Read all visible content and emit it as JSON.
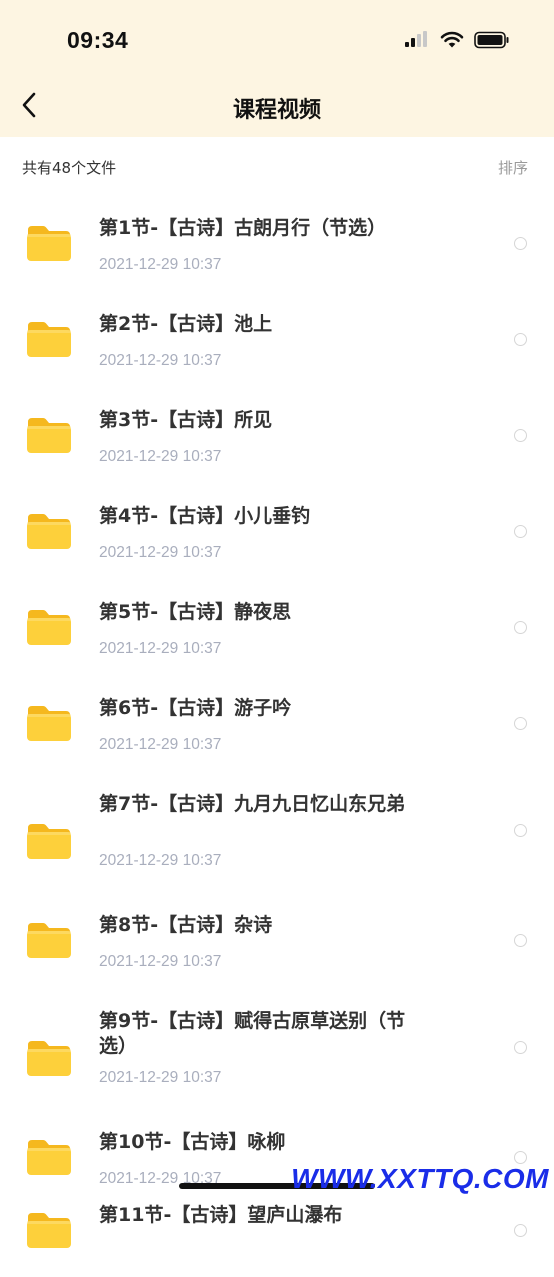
{
  "status_bar": {
    "time": "09:34"
  },
  "nav": {
    "title": "课程视频"
  },
  "toolbar": {
    "file_count": "共有48个文件",
    "sort_label": "排序"
  },
  "files": [
    {
      "title": "第1节-【古诗】古朗月行（节选）",
      "date": "2021-12-29 10:37"
    },
    {
      "title": "第2节-【古诗】池上",
      "date": "2021-12-29 10:37"
    },
    {
      "title": "第3节-【古诗】所见",
      "date": "2021-12-29 10:37"
    },
    {
      "title": "第4节-【古诗】小儿垂钓",
      "date": "2021-12-29 10:37"
    },
    {
      "title": "第5节-【古诗】静夜思",
      "date": "2021-12-29 10:37"
    },
    {
      "title": "第6节-【古诗】游子吟",
      "date": "2021-12-29 10:37"
    },
    {
      "title": "第7节-【古诗】九月九日忆山东兄弟",
      "date": "2021-12-29 10:37"
    },
    {
      "title": "第8节-【古诗】杂诗",
      "date": "2021-12-29 10:37"
    },
    {
      "title": "第9节-【古诗】赋得古原草送别（节选）",
      "date": "2021-12-29 10:37"
    },
    {
      "title": "第10节-【古诗】咏柳",
      "date": "2021-12-29 10:37"
    },
    {
      "title": "第11节-【古诗】望庐山瀑布",
      "date": ""
    }
  ],
  "watermark": "WWW.XXTTQ.COM",
  "colors": {
    "header_bg": "#fdf5e2",
    "folder": "#fbc02d",
    "date": "#a9aebd",
    "watermark": "#1a2de8"
  }
}
